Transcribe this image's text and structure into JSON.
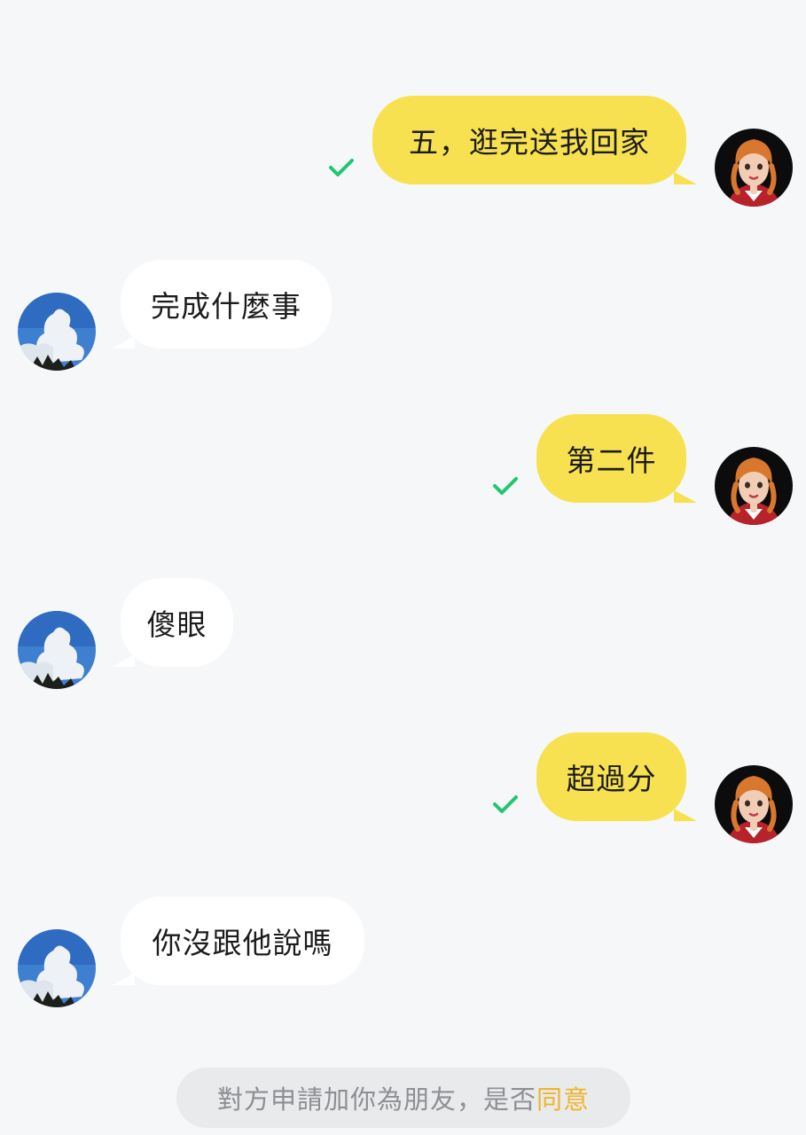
{
  "colors": {
    "background": "#f6f7f9",
    "sent_bubble": "#f7e150",
    "received_bubble": "#ffffff",
    "read_check": "#1fc76e",
    "accent": "#f0b42a",
    "request_text": "#8d8f93"
  },
  "messages": [
    {
      "direction": "sent",
      "text": "五，逛完送我回家",
      "status": "read",
      "status_icon": "check-icon"
    },
    {
      "direction": "received",
      "text": "完成什麼事"
    },
    {
      "direction": "sent",
      "text": "第二件",
      "status": "read",
      "status_icon": "check-icon"
    },
    {
      "direction": "received",
      "text": "傻眼"
    },
    {
      "direction": "sent",
      "text": "超過分",
      "status": "read",
      "status_icon": "check-icon"
    },
    {
      "direction": "received",
      "text": "你沒跟他說嗎"
    }
  ],
  "avatars": {
    "self": "cartoon-girl-avatar-icon",
    "contact": "sky-clouds-avatar-icon"
  },
  "friend_request": {
    "text": "對方申請加你為朋友，是否",
    "action_label": "同意"
  }
}
